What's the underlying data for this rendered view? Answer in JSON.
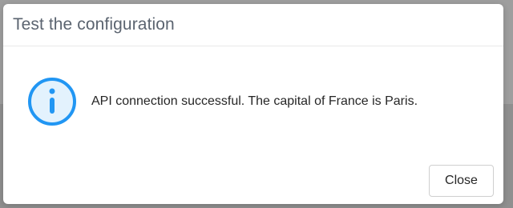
{
  "dialog": {
    "title": "Test the configuration",
    "message": "API connection successful. The capital of France is Paris.",
    "icon": "info-icon",
    "close_label": "Close"
  },
  "colors": {
    "accent": "#2196f3",
    "icon_fill": "#e3f2fd",
    "title": "#5b6470",
    "text": "#262626"
  }
}
